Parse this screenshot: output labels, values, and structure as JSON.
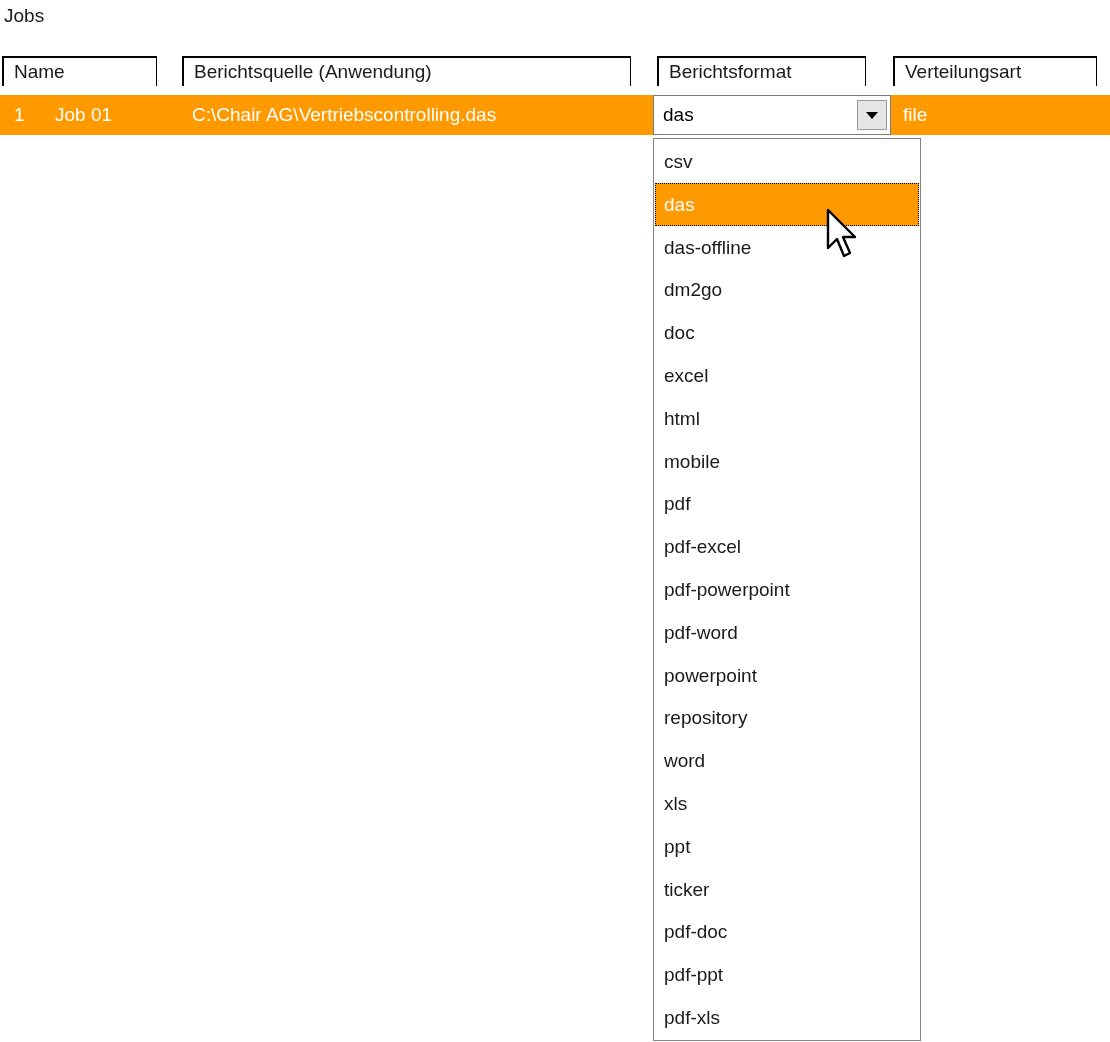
{
  "title": "Jobs",
  "columns": [
    "Name",
    "Berichtsquelle (Anwendung)",
    "Berichtsformat",
    "Verteilungsart"
  ],
  "rows": [
    {
      "number": "1",
      "name": "Job 01",
      "source": "C:\\Chair AG\\Vertriebscontrolling.das",
      "format": "das",
      "distribution": "file",
      "selected": true
    }
  ],
  "format_dropdown": {
    "expanded": true,
    "options": [
      {
        "label": "csv",
        "selected": false
      },
      {
        "label": "das",
        "selected": true
      },
      {
        "label": "das-offline",
        "selected": false
      },
      {
        "label": "dm2go",
        "selected": false
      },
      {
        "label": "doc",
        "selected": false
      },
      {
        "label": "excel",
        "selected": false
      },
      {
        "label": "html",
        "selected": false
      },
      {
        "label": "mobile",
        "selected": false
      },
      {
        "label": "pdf",
        "selected": false
      },
      {
        "label": "pdf-excel",
        "selected": false
      },
      {
        "label": "pdf-powerpoint",
        "selected": false
      },
      {
        "label": "pdf-word",
        "selected": false
      },
      {
        "label": "powerpoint",
        "selected": false
      },
      {
        "label": "repository",
        "selected": false
      },
      {
        "label": "word",
        "selected": false
      },
      {
        "label": "xls",
        "selected": false
      },
      {
        "label": "ppt",
        "selected": false
      },
      {
        "label": "ticker",
        "selected": false
      },
      {
        "label": "pdf-doc",
        "selected": false
      },
      {
        "label": "pdf-ppt",
        "selected": false
      },
      {
        "label": "pdf-xls",
        "selected": false
      }
    ]
  }
}
